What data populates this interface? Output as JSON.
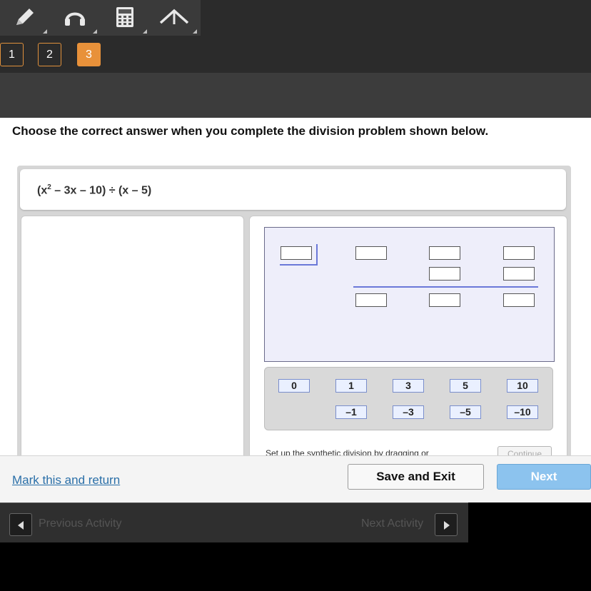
{
  "toolbar": {
    "tools": [
      {
        "icon": "pencil-icon"
      },
      {
        "icon": "headphones-icon"
      },
      {
        "icon": "calculator-icon"
      },
      {
        "icon": "reference-icon"
      }
    ]
  },
  "question_nav": {
    "items": [
      "1",
      "2",
      "3"
    ],
    "active": "3"
  },
  "prompt": "Choose the correct answer when you complete the division problem shown below.",
  "expression": {
    "open1": "(x",
    "exp": "2",
    "rest": " – 3x – 10) ÷ (x – 5)"
  },
  "tiles": {
    "row1": [
      "0",
      "1",
      "3",
      "5",
      "10"
    ],
    "row2": [
      "–1",
      "–3",
      "–5",
      "–10"
    ]
  },
  "hint": "Set up the synthetic division by dragging or",
  "continue_label": "Continue",
  "footer": {
    "mark_label": "Mark this and return",
    "save_label": "Save and Exit",
    "next_label": "Next"
  },
  "activity_nav": {
    "prev_label": "Previous Activity",
    "next_label": "Next Activity"
  },
  "colors": {
    "accent_orange": "#e8913a",
    "next_button": "#8cc3ee",
    "link": "#2a6fa8"
  }
}
